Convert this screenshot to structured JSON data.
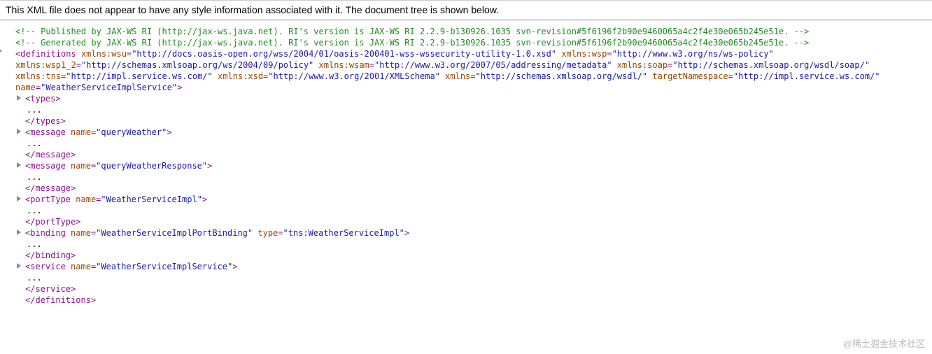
{
  "header": "This XML file does not appear to have any style information associated with it. The document tree is shown below.",
  "comments": [
    "<!--  Published by JAX-WS RI (http://jax-ws.java.net). RI's version is JAX-WS RI 2.2.9-b130926.1035 svn-revision#5f6196f2b90e9460065a4c2f4e30e065b245e51e.  -->",
    "<!--  Generated by JAX-WS RI (http://jax-ws.java.net). RI's version is JAX-WS RI 2.2.9-b130926.1035 svn-revision#5f6196f2b90e9460065a4c2f4e30e065b245e51e.  -->"
  ],
  "defs": {
    "lines": [
      [
        {
          "t": "tag",
          "v": "<definitions"
        },
        {
          "t": "sp"
        },
        {
          "t": "attr-name",
          "v": "xmlns:wsu"
        },
        {
          "t": "tag",
          "v": "="
        },
        {
          "t": "attr-value",
          "v": "\"http://docs.oasis-open.org/wss/2004/01/oasis-200401-wss-wssecurity-utility-1.0.xsd\""
        },
        {
          "t": "sp"
        },
        {
          "t": "attr-name",
          "v": "xmlns:wsp"
        },
        {
          "t": "tag",
          "v": "="
        },
        {
          "t": "attr-value",
          "v": "\"http://www.w3.org/ns/ws-policy\""
        }
      ],
      [
        {
          "t": "attr-name",
          "v": "xmlns:wsp1_2"
        },
        {
          "t": "tag",
          "v": "="
        },
        {
          "t": "attr-value",
          "v": "\"http://schemas.xmlsoap.org/ws/2004/09/policy\""
        },
        {
          "t": "sp"
        },
        {
          "t": "attr-name",
          "v": "xmlns:wsam"
        },
        {
          "t": "tag",
          "v": "="
        },
        {
          "t": "attr-value",
          "v": "\"http://www.w3.org/2007/05/addressing/metadata\""
        },
        {
          "t": "sp"
        },
        {
          "t": "attr-name",
          "v": "xmlns:soap"
        },
        {
          "t": "tag",
          "v": "="
        },
        {
          "t": "attr-value",
          "v": "\"http://schemas.xmlsoap.org/wsdl/soap/\""
        }
      ],
      [
        {
          "t": "attr-name",
          "v": "xmlns:tns"
        },
        {
          "t": "tag",
          "v": "="
        },
        {
          "t": "attr-value",
          "v": "\"http://impl.service.ws.com/\""
        },
        {
          "t": "sp"
        },
        {
          "t": "attr-name",
          "v": "xmlns:xsd"
        },
        {
          "t": "tag",
          "v": "="
        },
        {
          "t": "attr-value",
          "v": "\"http://www.w3.org/2001/XMLSchema\""
        },
        {
          "t": "sp"
        },
        {
          "t": "attr-name",
          "v": "xmlns"
        },
        {
          "t": "tag",
          "v": "="
        },
        {
          "t": "attr-value",
          "v": "\"http://schemas.xmlsoap.org/wsdl/\""
        },
        {
          "t": "sp"
        },
        {
          "t": "attr-name",
          "v": "targetNamespace"
        },
        {
          "t": "tag",
          "v": "="
        },
        {
          "t": "attr-value",
          "v": "\"http://impl.service.ws.com/\""
        }
      ],
      [
        {
          "t": "attr-name",
          "v": "name"
        },
        {
          "t": "tag",
          "v": "="
        },
        {
          "t": "attr-value",
          "v": "\"WeatherServiceImplService\""
        },
        {
          "t": "tag",
          "v": ">"
        }
      ]
    ]
  },
  "children": [
    {
      "open": [
        {
          "t": "tag",
          "v": "<types>"
        }
      ],
      "close": "</types>"
    },
    {
      "open": [
        {
          "t": "tag",
          "v": "<message"
        },
        {
          "t": "sp"
        },
        {
          "t": "attr-name",
          "v": "name"
        },
        {
          "t": "tag",
          "v": "="
        },
        {
          "t": "attr-value",
          "v": "\"queryWeather\""
        },
        {
          "t": "tag",
          "v": ">"
        }
      ],
      "close": "</message>"
    },
    {
      "open": [
        {
          "t": "tag",
          "v": "<message"
        },
        {
          "t": "sp"
        },
        {
          "t": "attr-name",
          "v": "name"
        },
        {
          "t": "tag",
          "v": "="
        },
        {
          "t": "attr-value",
          "v": "\"queryWeatherResponse\""
        },
        {
          "t": "tag",
          "v": ">"
        }
      ],
      "close": "</message>"
    },
    {
      "open": [
        {
          "t": "tag",
          "v": "<portType"
        },
        {
          "t": "sp"
        },
        {
          "t": "attr-name",
          "v": "name"
        },
        {
          "t": "tag",
          "v": "="
        },
        {
          "t": "attr-value",
          "v": "\"WeatherServiceImpl\""
        },
        {
          "t": "tag",
          "v": ">"
        }
      ],
      "close": "</portType>"
    },
    {
      "open": [
        {
          "t": "tag",
          "v": "<binding"
        },
        {
          "t": "sp"
        },
        {
          "t": "attr-name",
          "v": "name"
        },
        {
          "t": "tag",
          "v": "="
        },
        {
          "t": "attr-value",
          "v": "\"WeatherServiceImplPortBinding\""
        },
        {
          "t": "sp"
        },
        {
          "t": "attr-name",
          "v": "type"
        },
        {
          "t": "tag",
          "v": "="
        },
        {
          "t": "attr-value",
          "v": "\"tns:WeatherServiceImpl\""
        },
        {
          "t": "tag",
          "v": ">"
        }
      ],
      "close": "</binding>"
    },
    {
      "open": [
        {
          "t": "tag",
          "v": "<service"
        },
        {
          "t": "sp"
        },
        {
          "t": "attr-name",
          "v": "name"
        },
        {
          "t": "tag",
          "v": "="
        },
        {
          "t": "attr-value",
          "v": "\"WeatherServiceImplService\""
        },
        {
          "t": "tag",
          "v": ">"
        }
      ],
      "close": "</service>"
    }
  ],
  "defsClose": "</definitions>",
  "ellipsis": "...",
  "watermark": "@稀土掘金技术社区"
}
